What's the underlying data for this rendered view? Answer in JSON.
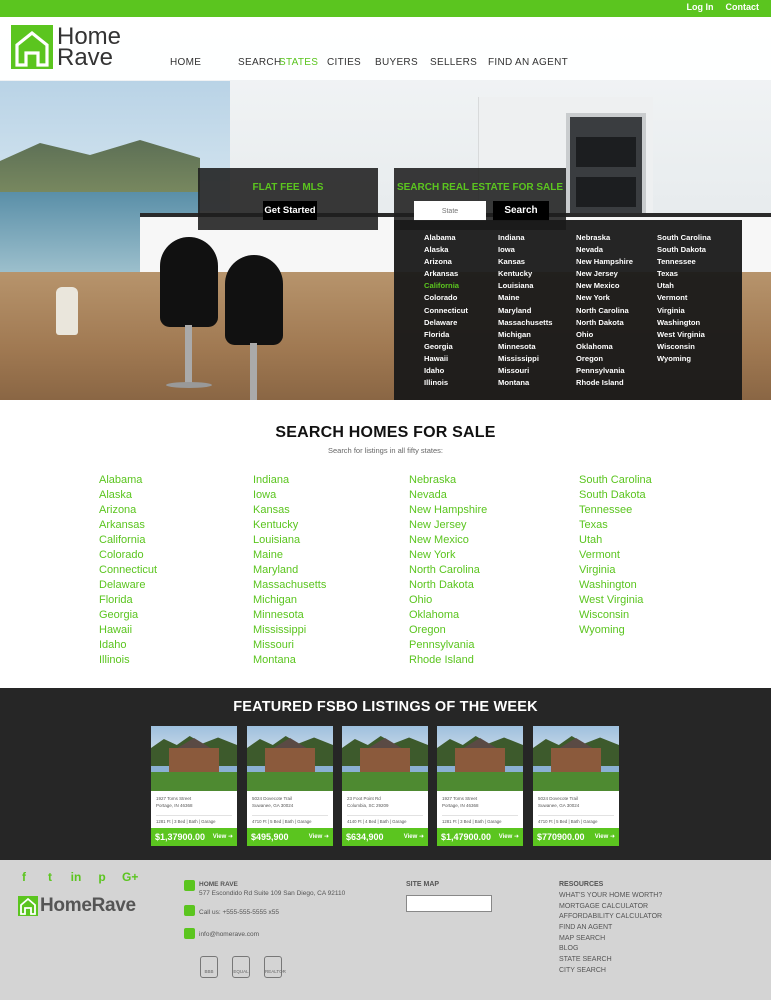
{
  "topbar": {
    "login": "Log In",
    "contact": "Contact"
  },
  "brand": {
    "name_line1": "Home",
    "name_line2": "Rave",
    "accent": "#5bc51f"
  },
  "nav": [
    "HOME",
    "SEARCH",
    "STATES",
    "CITIES",
    "BUYERS",
    "SELLERS",
    "FIND AN AGENT"
  ],
  "nav_active": "STATES",
  "hero": {
    "fee": {
      "title": "FLAT FEE MLS",
      "button": "Get Started"
    },
    "search": {
      "title": "SEARCH REAL ESTATE FOR SALE",
      "placeholder": "State",
      "button": "Search"
    }
  },
  "dropdown_columns": [
    [
      "Alabama",
      "Alaska",
      "Arizona",
      "Arkansas",
      "California",
      "Colorado",
      "Connecticut",
      "Delaware",
      "Florida",
      "Georgia",
      "Hawaii",
      "Idaho",
      "Illinois"
    ],
    [
      "Indiana",
      "Iowa",
      "Kansas",
      "Kentucky",
      "Louisiana",
      "Maine",
      "Maryland",
      "Massachusetts",
      "Michigan",
      "Minnesota",
      "Mississippi",
      "Missouri",
      "Montana"
    ],
    [
      "Nebraska",
      "Nevada",
      "New Hampshire",
      "New Jersey",
      "New Mexico",
      "New York",
      "North Carolina",
      "North Dakota",
      "Ohio",
      "Oklahoma",
      "Oregon",
      "Pennsylvania",
      "Rhode Island"
    ],
    [
      "South Carolina",
      "South Dakota",
      "Tennessee",
      "Texas",
      "Utah",
      "Vermont",
      "Virginia",
      "Washington",
      "West Virginia",
      "Wisconsin",
      "Wyoming"
    ]
  ],
  "dropdown_highlight": "California",
  "states_section": {
    "title": "SEARCH HOMES FOR SALE",
    "subtitle": "Search for listings in all fifty states:",
    "columns": [
      [
        "Alabama",
        "Alaska",
        "Arizona",
        "Arkansas",
        "California",
        "Colorado",
        "Connecticut",
        "Delaware",
        "Florida",
        "Georgia",
        "Hawaii",
        "Idaho",
        "Illinois"
      ],
      [
        "Indiana",
        "Iowa",
        "Kansas",
        "Kentucky",
        "Louisiana",
        "Maine",
        "Maryland",
        "Massachusetts",
        "Michigan",
        "Minnesota",
        "Mississippi",
        "Missouri",
        "Montana"
      ],
      [
        "Nebraska",
        "Nevada",
        "New Hampshire",
        "New Jersey",
        "New Mexico",
        "New York",
        "North Carolina",
        "North Dakota",
        "Ohio",
        "Oklahoma",
        "Oregon",
        "Pennsylvania",
        "Rhode Island"
      ],
      [
        "South Carolina",
        "South Dakota",
        "Tennessee",
        "Texas",
        "Utah",
        "Vermont",
        "Virginia",
        "Washington",
        "West Virginia",
        "Wisconsin",
        "Wyoming"
      ]
    ]
  },
  "featured": {
    "title": "FEATURED FSBO LISTINGS OF THE WEEK",
    "listings": [
      {
        "street": "1927 Toms Street",
        "city": "Portage, IN 46368",
        "specs": "1281 Ft | 3 Bed | Bath | Garage",
        "price": "$1,37900.00",
        "view": "View ➜"
      },
      {
        "street": "5024 Dovecote Trail",
        "city": "Suwanee, GA 30024",
        "specs": "4710 Ft | 5 Bed | Bath | Garage",
        "price": "$495,900",
        "view": "View ➜"
      },
      {
        "street": "23 Foot Point Rd",
        "city": "Columbia, SC 29209",
        "specs": "4140 Ft | 4 Bed | Bath | Garage",
        "price": "$634,900",
        "view": "View ➜"
      },
      {
        "street": "1927 Toms Street",
        "city": "Portage, IN 46368",
        "specs": "1281 Ft | 3 Bed | Bath | Garage",
        "price": "$1,47900.00",
        "view": "View ➜"
      },
      {
        "street": "5024 Dovecote Trail",
        "city": "Suwanee, GA 30024",
        "specs": "4710 Ft | 5 Bed | Bath | Garage",
        "price": "$770900.00",
        "view": "View ➜"
      }
    ]
  },
  "footer": {
    "social": [
      "f",
      "t",
      "in",
      "p",
      "G+"
    ],
    "logo": "HomeRave",
    "company": "HOME RAVE",
    "address": "577 Escondido Rd  Suite 109 San Diego, CA 92110",
    "phone": "Call us: +555-555-5555 x55",
    "email": "info@homerave.com",
    "badges": [
      "BBB",
      "EQUAL HOUSING",
      "REALTOR"
    ],
    "sitemap_label": "SITE MAP",
    "resources_label": "RESOURCES",
    "resources": [
      "WHAT'S YOUR HOME WORTH?",
      "MORTGAGE CALCULATOR",
      "AFFORDABILITY CALCULATOR",
      "FIND AN AGENT",
      "MAP SEARCH",
      "BLOG",
      "STATE SEARCH",
      "CITY SEARCH"
    ]
  }
}
